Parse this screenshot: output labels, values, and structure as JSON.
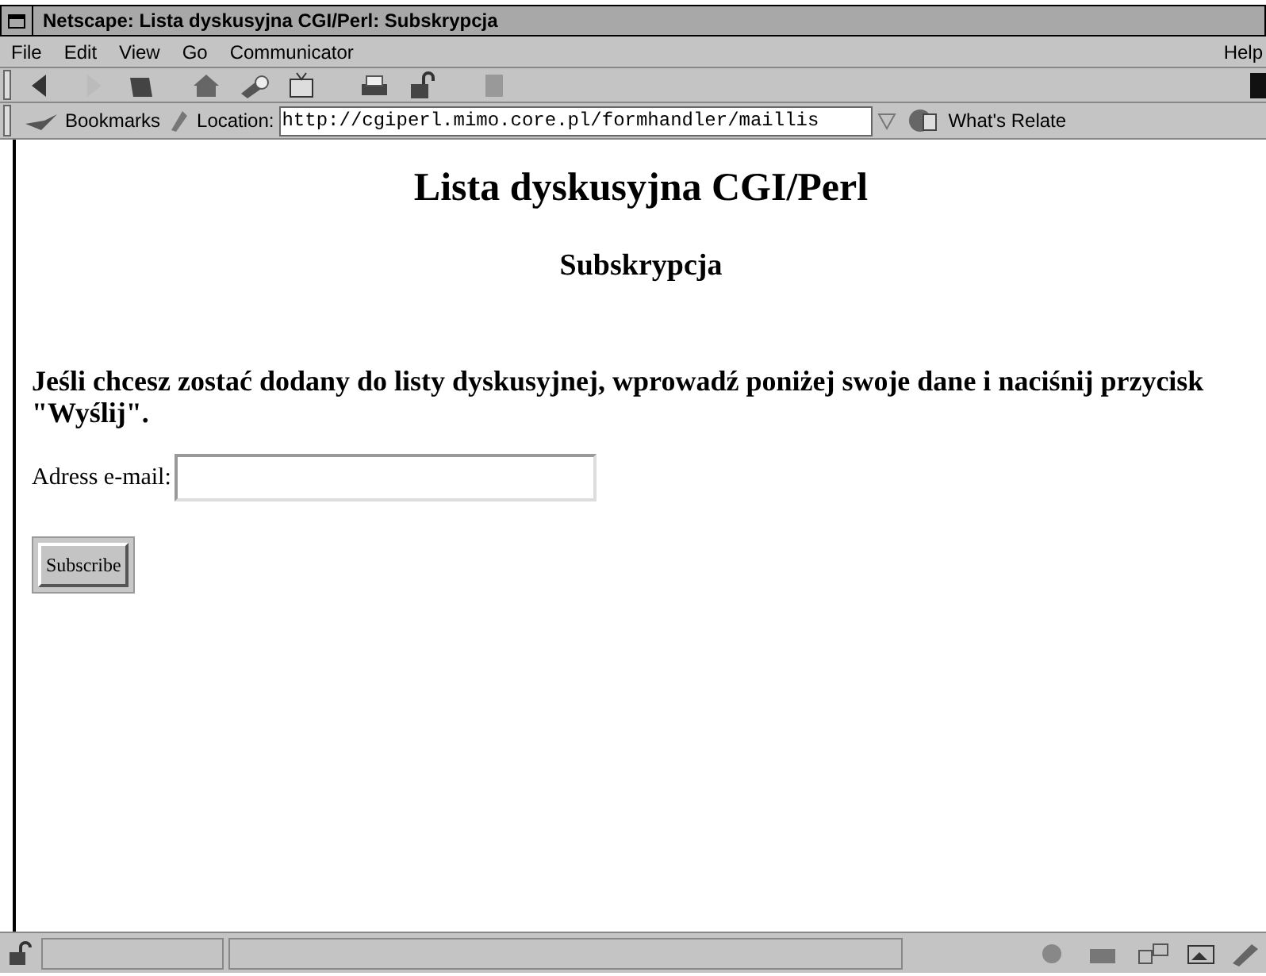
{
  "window": {
    "title": "Netscape: Lista dyskusyjna CGI/Perl: Subskrypcja"
  },
  "menu": [
    "File",
    "Edit",
    "View",
    "Go",
    "Communicator",
    "Help"
  ],
  "location_bar": {
    "bookmarks": "Bookmarks",
    "label": "Location:",
    "url": "http://cgiperl.mimo.core.pl/formhandler/maillis",
    "related": "What's Relate"
  },
  "page": {
    "heading": "Lista dyskusyjna CGI/Perl",
    "subheading": "Subskrypcja",
    "intro": "Jeśli chcesz zostać dodany do listy dyskusyjnej, wprowadź poniżej swoje dane i naciśnij przycisk \"Wyślij\".",
    "email_label": "Adress e-mail:",
    "submit": "Subscribe"
  }
}
